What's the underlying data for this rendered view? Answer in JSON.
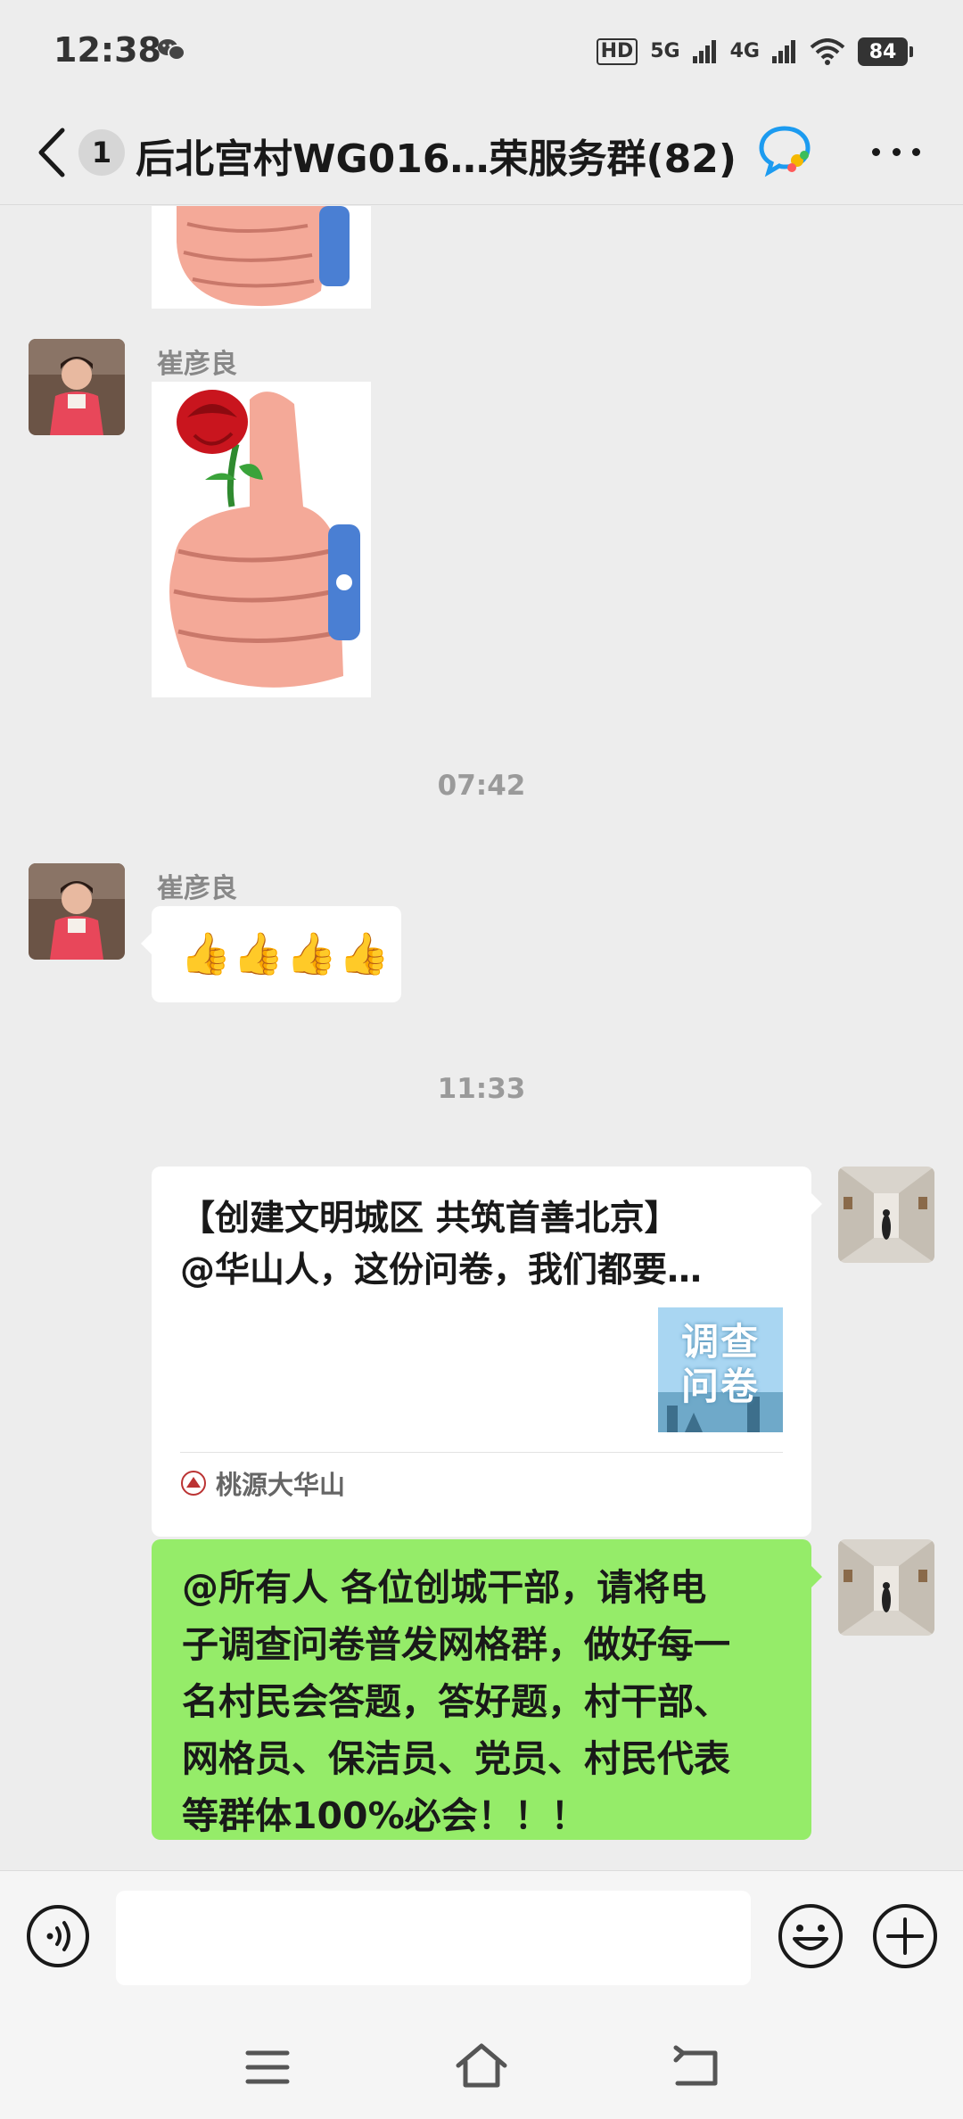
{
  "status_bar": {
    "time": "12:38",
    "network_badges": [
      "HD",
      "5G",
      "4G"
    ],
    "battery": "84"
  },
  "header": {
    "unread_count": "1",
    "title": "后北宫村WG016…荣服务群(82)"
  },
  "messages": {
    "sender_1": "崔彦良",
    "timestamp_1": "07:42",
    "sender_2": "崔彦良",
    "emoji_message": "👍👍👍👍",
    "timestamp_2": "11:33",
    "share_card": {
      "title_line1": "【创建文明城区 共筑首善北京】",
      "title_line2": "@华山人，这份问卷，我们都要…",
      "thumbnail_text": "调查问卷",
      "source": "桃源大华山"
    },
    "green_message": {
      "line1": "@所有人  各位创城干部，请将电",
      "line2": "子调查问卷普发网格群，做好每一",
      "line3": "名村民会答题，答好题，村干部、",
      "line4": "网格员、保洁员、党员、村民代表",
      "line5": "等群体100%必会！！！"
    }
  },
  "input_bar": {
    "placeholder": ""
  },
  "colors": {
    "background": "#ededed",
    "green_bubble": "#95ec69",
    "white_bubble": "#ffffff"
  }
}
